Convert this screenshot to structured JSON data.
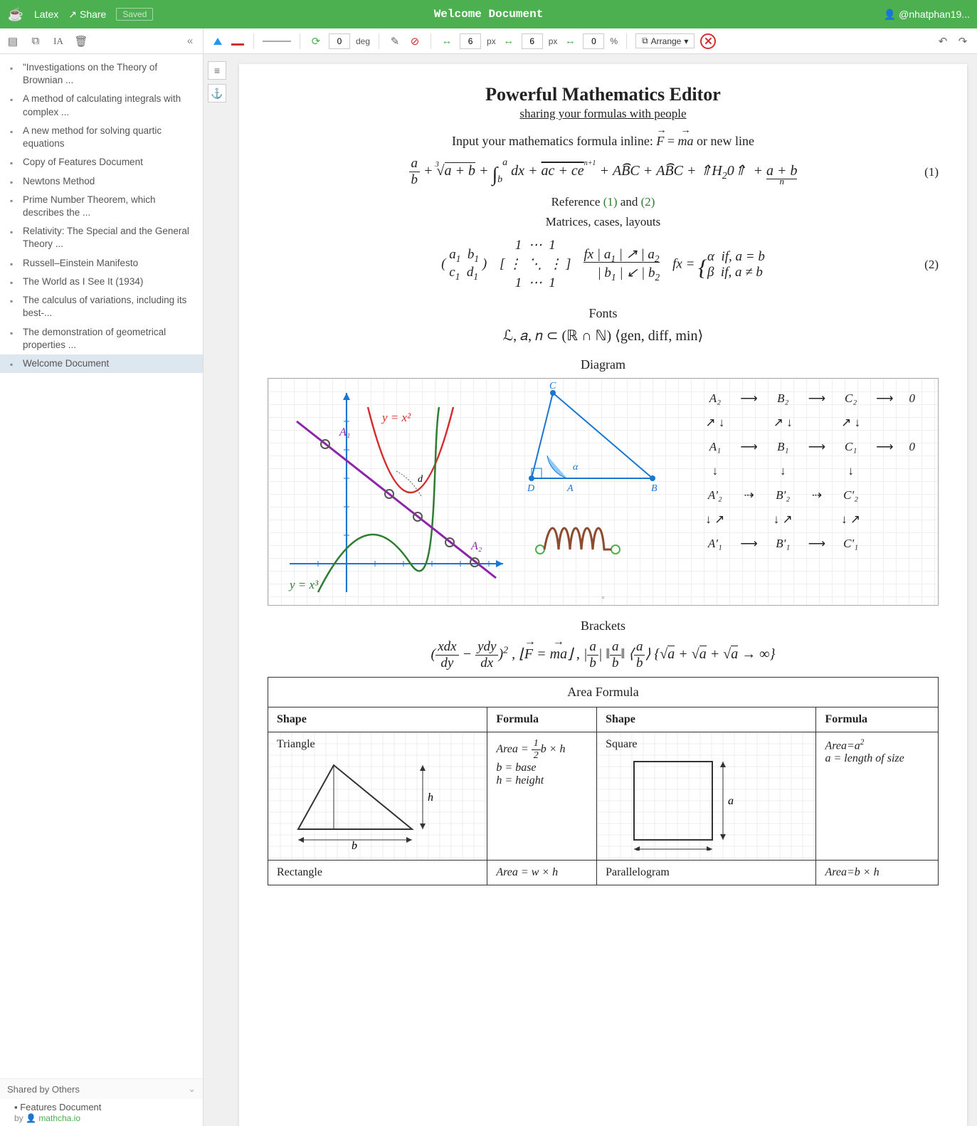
{
  "header": {
    "latex_btn": "Latex",
    "share_btn": "Share",
    "saved_btn": "Saved",
    "title": "Welcome Document",
    "user": "@nhatphan19..."
  },
  "toolbar": {
    "rotate_value": "0",
    "rotate_unit": "deg",
    "px1_value": "6",
    "px1_unit": "px",
    "px2_value": "6",
    "px2_unit": "px",
    "pct_value": "0",
    "pct_unit": "%",
    "arrange_label": "Arrange"
  },
  "sidebar": {
    "docs": [
      "\"Investigations on the Theory of Brownian ...",
      "A method of calculating integrals with complex ...",
      "A new method for solving quartic equations",
      "Copy of Features Document",
      "Newtons Method",
      "Prime Number Theorem, which describes the ...",
      "Relativity: The Special and the General Theory ...",
      "Russell–Einstein Manifesto",
      "The World as I See It (1934)",
      "The calculus of variations, including its best-...",
      "The demonstration of geometrical properties ...",
      "Welcome Document"
    ],
    "selected_index": 11,
    "shared_header": "Shared by Others",
    "shared_doc": "Features Document",
    "shared_by_prefix": "by ",
    "shared_by_link": "mathcha.io"
  },
  "page": {
    "title": "Powerful Mathematics Editor",
    "subtitle": "sharing your formulas with people",
    "inline_prefix": "Input your mathematics formula inline: ",
    "inline_mid": " = ",
    "inline_suffix": " or new line",
    "eq1_num": "(1)",
    "ref_line_a": "Reference ",
    "ref_1": "(1)",
    "ref_and": " and ",
    "ref_2": "(2)",
    "matrices_label": "Matrices, cases, layouts",
    "eq2_num": "(2)",
    "fonts_label": "Fonts",
    "fonts_math": "ℒ, 𝑎, 𝑛 ⊂ (ℝ ∩ ℕ) ⟨gen, diff, min⟩",
    "diagram_label": "Diagram",
    "brackets_label": "Brackets",
    "area_title": "Area Formula",
    "col_shape": "Shape",
    "col_formula": "Formula",
    "shapes": {
      "triangle": "Triangle",
      "triangle_formula": "Area = ½b × h\nb = base\nh = height",
      "square": "Square",
      "square_formula": "Area=a²\na = length of size",
      "rectangle": "Rectangle",
      "rectangle_formula": "Area = w × h",
      "parallelogram": "Parallelogram",
      "parallelogram_formula": "Area=b × h"
    },
    "diagram_labels": {
      "yx2": "y = x²",
      "yx3": "y = x³",
      "A1": "A₁",
      "A2": "A₂",
      "C": "C",
      "D": "D",
      "A": "A",
      "B": "B",
      "alpha": "α",
      "d": "d"
    },
    "cd": {
      "r1": [
        "A₂",
        "B₂",
        "C₂",
        "0"
      ],
      "r2": [
        "A₁",
        "B₁",
        "C₁",
        "0"
      ],
      "r3": [
        "A'₂",
        "B'₂",
        "C'₂",
        ""
      ],
      "r4": [
        "A'₁",
        "B'₁",
        "C'₁",
        ""
      ]
    }
  }
}
